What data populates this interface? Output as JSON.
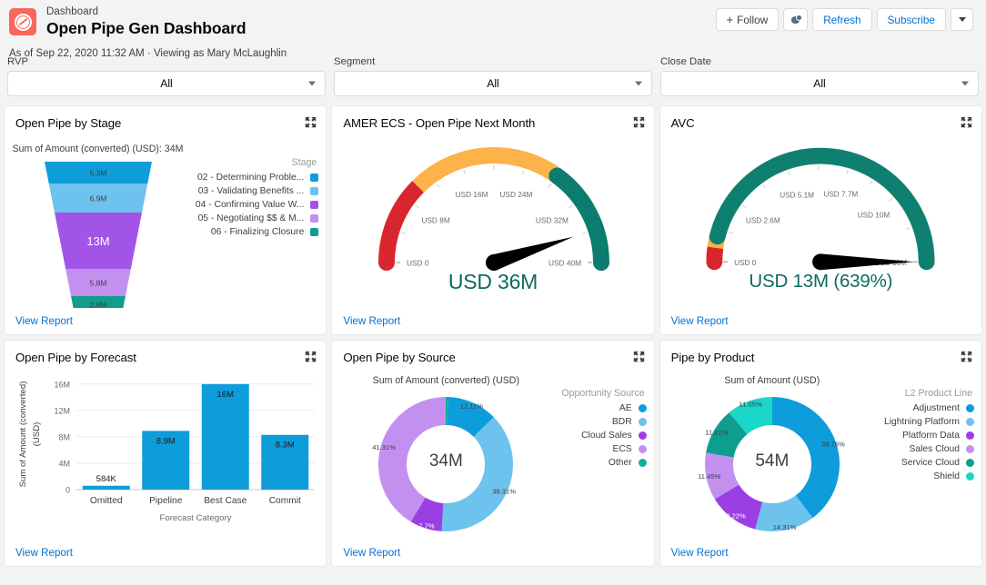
{
  "header": {
    "breadcrumb": "Dashboard",
    "title": "Open Pipe Gen Dashboard",
    "subline": "As of Sep 22, 2020 11:32 AM · Viewing as Mary McLaughlin",
    "logo_icon": "gauge-logo-icon",
    "actions": {
      "follow": "Follow",
      "follow_plus": "+",
      "notify_icon": "bell-icon",
      "refresh": "Refresh",
      "subscribe": "Subscribe",
      "more_icon": "chevron-down-icon"
    }
  },
  "filters": [
    {
      "label": "RVP",
      "value": "All"
    },
    {
      "label": "Segment",
      "value": "All"
    },
    {
      "label": "Close Date",
      "value": "All"
    }
  ],
  "common": {
    "view_report": "View Report",
    "expand_icon": "expand-icon"
  },
  "colors": {
    "blue": "#0d9dda",
    "light_blue": "#6ec2ee",
    "purple": "#a254e8",
    "light_purple": "#c490f0",
    "teal": "#0f9e8e",
    "cyan": "#1ad7c8",
    "red": "#d9262e",
    "orange": "#fdb24a",
    "green": "#0b7c6e",
    "accent_link": "#0070d2",
    "gauge_text": "#0b6b5e"
  },
  "cards": {
    "funnel": {
      "title": "Open Pipe by Stage",
      "chart_heading": "Sum of Amount (converted) (USD): 34M",
      "legend_title": "Stage"
    },
    "gauge_amer": {
      "title": "AMER ECS - Open Pipe Next Month"
    },
    "gauge_avc": {
      "title": "AVC"
    },
    "bars": {
      "title": "Open Pipe by Forecast"
    },
    "donut_source": {
      "title": "Open Pipe by Source",
      "chart_heading": "Sum of Amount (converted) (USD)",
      "legend_title": "Opportunity Source",
      "center": "34M"
    },
    "donut_product": {
      "title": "Pipe by Product",
      "chart_heading": "Sum of Amount (USD)",
      "legend_title": "L2 Product Line",
      "center": "54M"
    }
  },
  "chart_data": [
    {
      "type": "funnel",
      "title": "Open Pipe by Stage",
      "subtitle": "Sum of Amount (converted) (USD): 34M",
      "legend_title": "Stage",
      "legend_position": "right",
      "total": "34M",
      "categories": [
        "02 - Determining Proble...",
        "03 - Validating Benefits ...",
        "04 - Confirming Value W...",
        "05 - Negotiating $$ & M...",
        "06 - Finalizing Closure"
      ],
      "value_labels": [
        "5.3M",
        "6.9M",
        "13M",
        "5.8M",
        "2.8M"
      ],
      "values": [
        5.3,
        6.9,
        13,
        5.8,
        2.8
      ],
      "colors": [
        "#0d9dda",
        "#6ec2ee",
        "#a254e8",
        "#c490f0",
        "#0f9e8e"
      ]
    },
    {
      "type": "gauge",
      "title": "AMER ECS - Open Pipe Next Month",
      "value": 36,
      "value_label": "USD 36M",
      "min": 0,
      "max": 40,
      "tick_labels": [
        "USD 0",
        "USD 8M",
        "USD 16M",
        "USD 24M",
        "USD 32M",
        "USD 40M"
      ],
      "tick_values": [
        0,
        8,
        16,
        24,
        32,
        40
      ],
      "bands": [
        {
          "from": 0,
          "to": 10,
          "color": "#d9262e"
        },
        {
          "from": 10,
          "to": 28,
          "color": "#fdb24a"
        },
        {
          "from": 28,
          "to": 40,
          "color": "#0b7c6e"
        }
      ]
    },
    {
      "type": "gauge",
      "title": "AVC",
      "value": 13,
      "value_label": "USD 13M (639%)",
      "min": 0,
      "max": 13,
      "tick_labels": [
        "USD 0",
        "USD 2.6M",
        "USD 5.1M",
        "USD 7.7M",
        "USD 10M",
        "USD 13M"
      ],
      "tick_values": [
        0,
        2.6,
        5.1,
        7.7,
        10,
        13
      ],
      "bands": [
        {
          "from": 0,
          "to": 0.55,
          "color": "#d9262e"
        },
        {
          "from": 0.55,
          "to": 1.0,
          "color": "#fdb24a"
        },
        {
          "from": 1.0,
          "to": 13,
          "color": "#0f8070"
        }
      ]
    },
    {
      "type": "bar",
      "title": "Open Pipe by Forecast",
      "xlabel": "Forecast Category",
      "ylabel": "Sum of Amount (converted) (USD)",
      "categories": [
        "Omitted",
        "Pipeline",
        "Best Case",
        "Commit"
      ],
      "values": [
        0.584,
        8.9,
        16,
        8.3
      ],
      "data_labels": [
        "584K",
        "8.9M",
        "16M",
        "8.3M"
      ],
      "ylim": [
        0,
        16
      ],
      "ytick_labels": [
        "0",
        "4M",
        "8M",
        "12M",
        "16M"
      ],
      "ytick_values": [
        0,
        4,
        8,
        12,
        16
      ],
      "grid": true,
      "color": "#0d9dda"
    },
    {
      "type": "pie",
      "title": "Open Pipe by Source",
      "subtitle": "Sum of Amount (converted) (USD)",
      "legend_title": "Opportunity Source",
      "legend_position": "right",
      "center_label": "34M",
      "categories": [
        "AE",
        "BDR",
        "Cloud Sales",
        "ECS",
        "Other"
      ],
      "values": [
        12.11,
        38.31,
        7.7,
        41.31,
        0.57
      ],
      "data_labels": [
        "12.11%",
        "38.31%",
        "7.7%",
        "41.31%",
        ""
      ],
      "colors": [
        "#0d9dda",
        "#6ec2ee",
        "#9b3fe4",
        "#c490f0",
        "#0fae9a"
      ]
    },
    {
      "type": "pie",
      "title": "Pipe by Product",
      "subtitle": "Sum of Amount (USD)",
      "legend_title": "L2 Product Line",
      "legend_position": "right",
      "center_label": "54M",
      "categories": [
        "Adjustment",
        "Lightning Platform",
        "Platform Data",
        "Sales Cloud",
        "Service Cloud",
        "Shield"
      ],
      "values": [
        39.76,
        14.31,
        12.22,
        11.45,
        11.21,
        11.05
      ],
      "data_labels": [
        "39.76%",
        "14.31%",
        "12.22%",
        "11.45%",
        "11.21%",
        "11.05%"
      ],
      "colors": [
        "#0d9dda",
        "#6ec2ee",
        "#9b3fe4",
        "#c490f0",
        "#0f9e8e",
        "#1ad7c8"
      ]
    }
  ]
}
